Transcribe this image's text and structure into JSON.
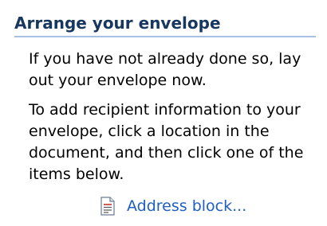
{
  "section": {
    "title": "Arrange your envelope",
    "paragraphs": [
      "If you have not already done so, lay out your envelope now.",
      "To add recipient information to your envelope, click a location in the document, and then click one of the items below."
    ],
    "link": {
      "label": "Address block...",
      "icon": "document-icon"
    }
  },
  "colors": {
    "header_text": "#17375e",
    "header_rule": "#a9c0e4",
    "link": "#1f5fbf"
  }
}
